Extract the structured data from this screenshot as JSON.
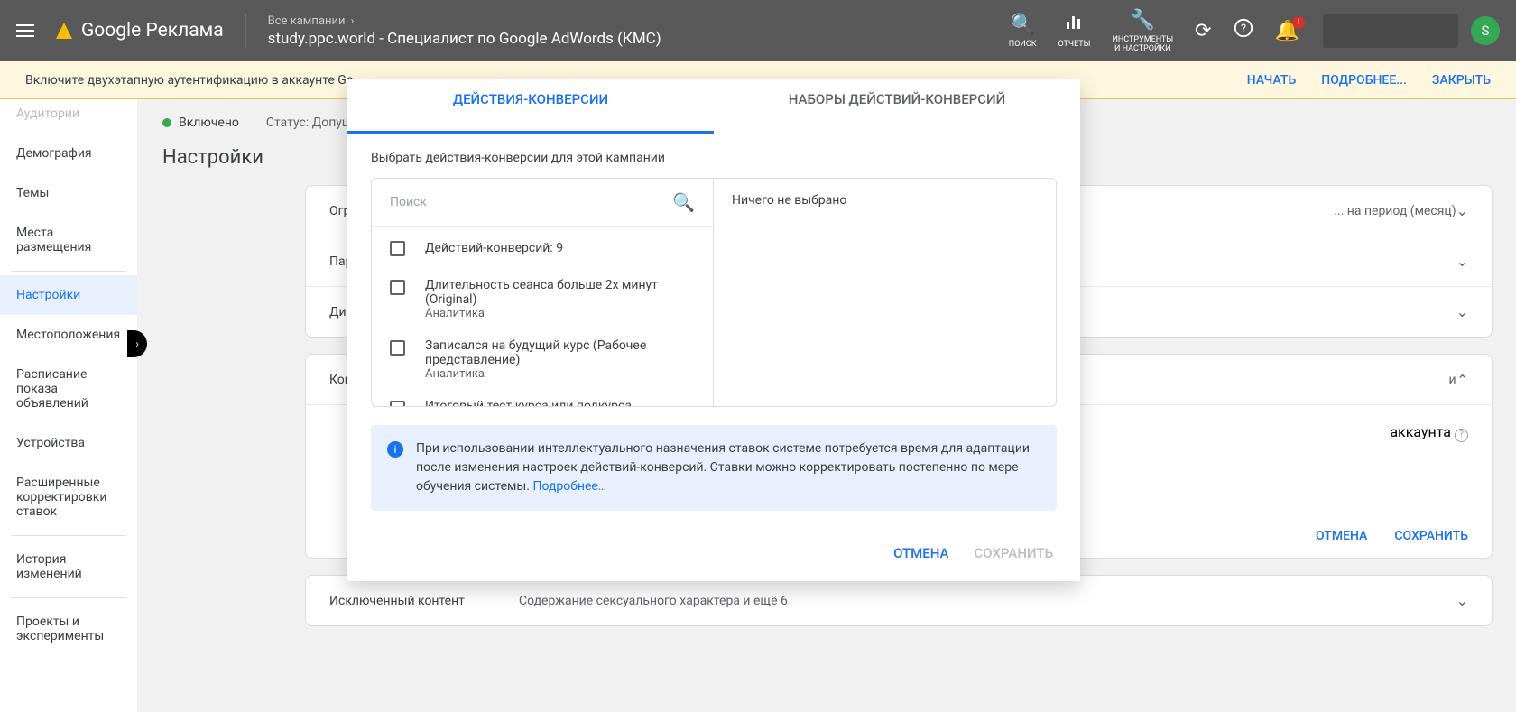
{
  "header": {
    "product": "Google Реклама",
    "breadcrumb_top": "Все кампании",
    "breadcrumb_main": "study.ppc.world - Специалист по Google AdWords (КМС)",
    "buttons": {
      "search": "ПОИСК",
      "reports": "ОТЧЕТЫ",
      "tools": "ИНСТРУМЕНТЫ\nИ НАСТРОЙКИ"
    },
    "avatar": "S",
    "badge": "!"
  },
  "notif": {
    "text": "Включите двухэтапную аутентификацию в аккаунте Go...",
    "actions": {
      "start": "НАЧАТЬ",
      "more": "ПОДРОБНЕЕ...",
      "close": "ЗАКРЫТЬ"
    }
  },
  "sidebar": {
    "items": [
      "Аудитории",
      "Демография",
      "Темы",
      "Места размещения",
      "Настройки",
      "Местоположения",
      "Расписание показа объявлений",
      "Устройства",
      "Расширенные корректировки ставок",
      "История изменений",
      "Проекты и эксперименты"
    ],
    "active_index": 4
  },
  "status": {
    "enabled": "Включено",
    "status_prefix": "Статус:",
    "status_value": "Допущ..."
  },
  "page_title": "Настройки",
  "cards": {
    "group1": [
      {
        "label": "Ограничение частоты показов",
        "value": "... на период (месяц)"
      },
      {
        "label": "Параметры",
        "value": ""
      },
      {
        "label": "Динамические",
        "value": ""
      }
    ],
    "group2": {
      "label": "Конверсии",
      "header_right": "и",
      "body_line": "аккаунта",
      "cancel": "ОТМЕНА",
      "save": "СОХРАНИТЬ"
    },
    "group3": {
      "label": "Исключенный контент",
      "value": "Содержание сексуального характера и ещё 6"
    }
  },
  "modal": {
    "tabs": {
      "conv": "ДЕЙСТВИЯ-КОНВЕРСИИ",
      "sets": "НАБОРЫ ДЕЙСТВИЙ-КОНВЕРСИЙ"
    },
    "subtitle": "Выбрать действия-конверсии для этой кампании",
    "search_placeholder": "Поиск",
    "count_label": "Действий-конверсий: 9",
    "items": [
      {
        "name": "Длительность сеанса больше 2х минут (Original)",
        "src": "Аналитика"
      },
      {
        "name": "Записался на будущий курс (Рабочее представление)",
        "src": "Аналитика"
      },
      {
        "name": "Итоговый тест курса или подкурса",
        "src": ""
      }
    ],
    "right_empty": "Ничего не выбрано",
    "info": "При использовании интеллектуального назначения ставок системе потребуется время для адаптации после изменения настроек действий-конверсий. Ставки можно корректировать постепенно по мере обучения системы.",
    "info_link": "Подробнее…",
    "actions": {
      "cancel": "ОТМЕНА",
      "save": "СОХРАНИТЬ"
    }
  }
}
